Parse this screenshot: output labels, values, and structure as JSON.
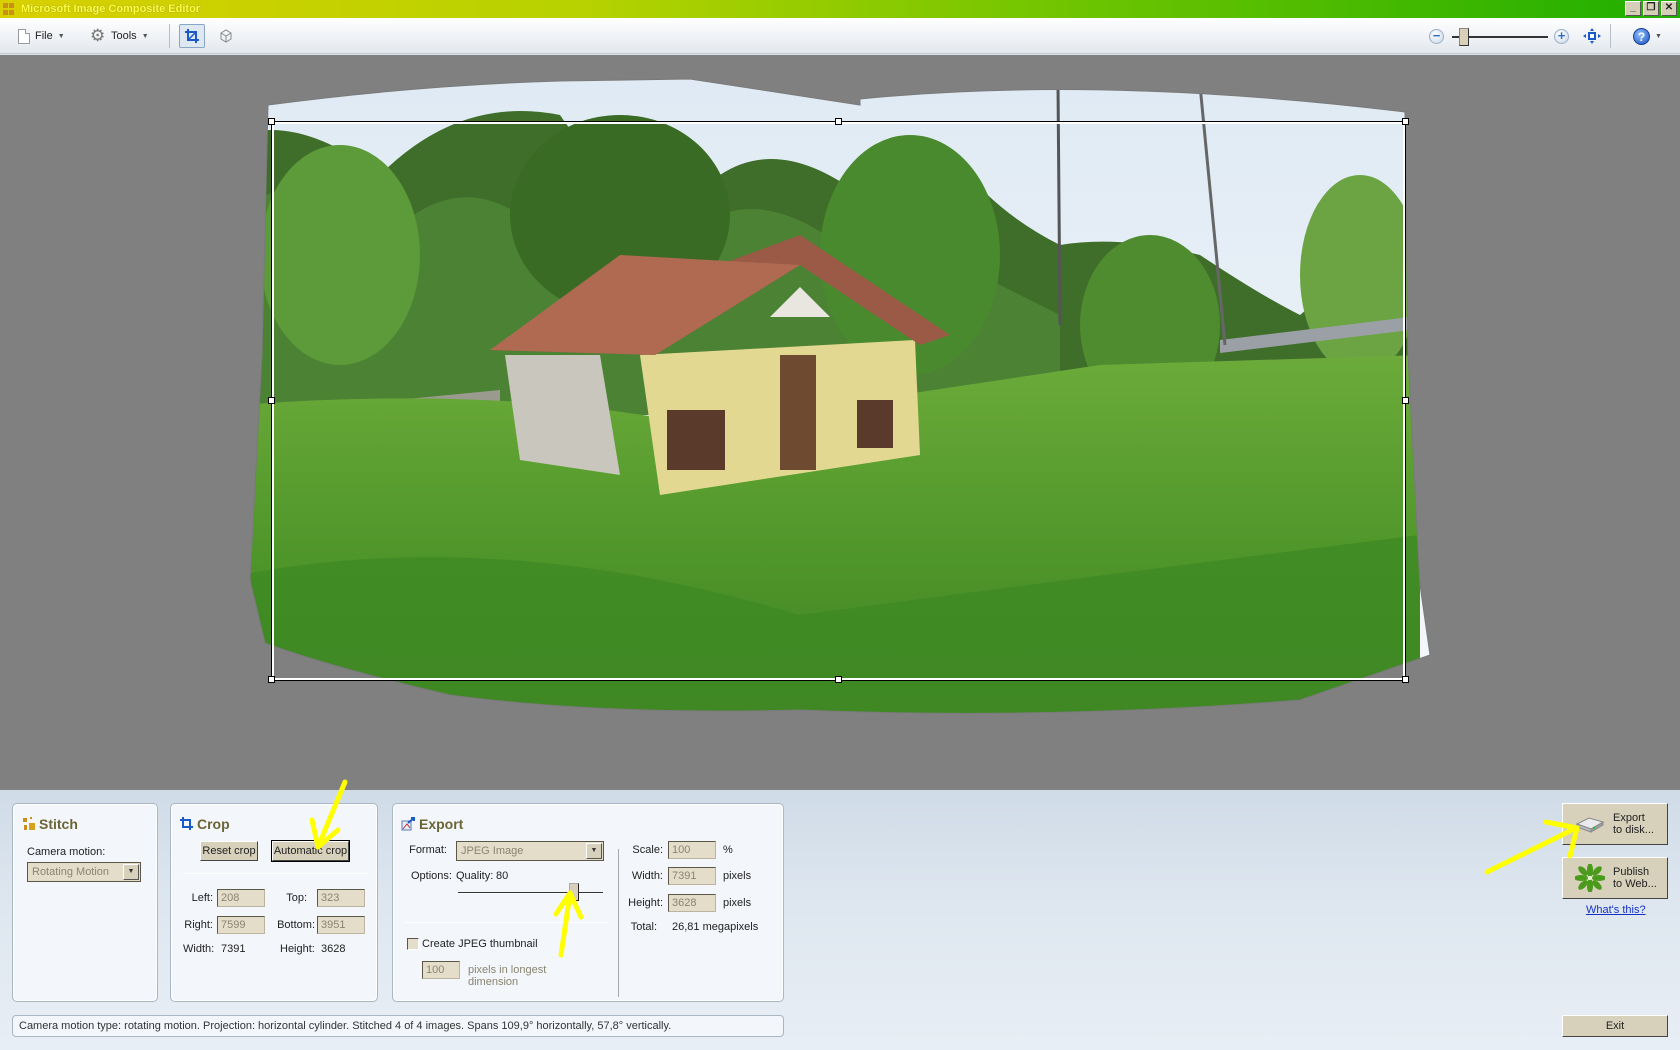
{
  "window": {
    "title": "Microsoft Image Composite Editor",
    "controls": [
      "_",
      "❐",
      "✕"
    ]
  },
  "toolbar": {
    "file_label": "File",
    "tools_label": "Tools",
    "crop_tool": "crop-icon",
    "projection_tool": "3d-box-icon",
    "zoom_level": 0.12
  },
  "canvas": {
    "background": "#808080",
    "crop_handles": 8
  },
  "stitch": {
    "title": "Stitch",
    "camera_motion_label": "Camera motion:",
    "camera_motion_value": "Rotating Motion"
  },
  "crop": {
    "title": "Crop",
    "reset_label": "Reset crop",
    "auto_label": "Automatic crop",
    "left_label": "Left:",
    "left_value": "208",
    "top_label": "Top:",
    "top_value": "323",
    "right_label": "Right:",
    "right_value": "7599",
    "bottom_label": "Bottom:",
    "bottom_value": "3951",
    "width_label": "Width:",
    "width_value": "7391",
    "height_label": "Height:",
    "height_value": "3628"
  },
  "export": {
    "title": "Export",
    "format_label": "Format:",
    "format_value": "JPEG Image",
    "options_label": "Options:",
    "quality_label": "Quality:",
    "quality_value": "80",
    "quality_slider_fraction": 0.8,
    "thumbnail_label": "Create JPEG thumbnail",
    "thumbnail_checked": false,
    "thumbnail_size_value": "100",
    "thumbnail_size_label_1": "pixels in longest",
    "thumbnail_size_label_2": "dimension",
    "scale_label": "Scale:",
    "scale_value": "100",
    "scale_unit": "%",
    "width_label": "Width:",
    "width_value": "7391",
    "width_unit": "pixels",
    "height_label": "Height:",
    "height_value": "3628",
    "height_unit": "pixels",
    "total_label": "Total:",
    "total_value": "26,81 megapixels"
  },
  "actions": {
    "export_disk_line1": "Export",
    "export_disk_line2": "to disk...",
    "publish_line1": "Publish",
    "publish_line2": "to Web...",
    "whats_this": "What's this?",
    "exit": "Exit"
  },
  "status": {
    "text": "Camera motion type: rotating motion. Projection: horizontal cylinder. Stitched 4 of 4 images. Spans 109,9° horizontally, 57,8° vertically."
  },
  "annotations": {
    "arrow_color": "#ffff00",
    "arrows": [
      "points-to-automatic-crop",
      "points-to-quality-slider",
      "points-to-export-to-disk"
    ]
  }
}
